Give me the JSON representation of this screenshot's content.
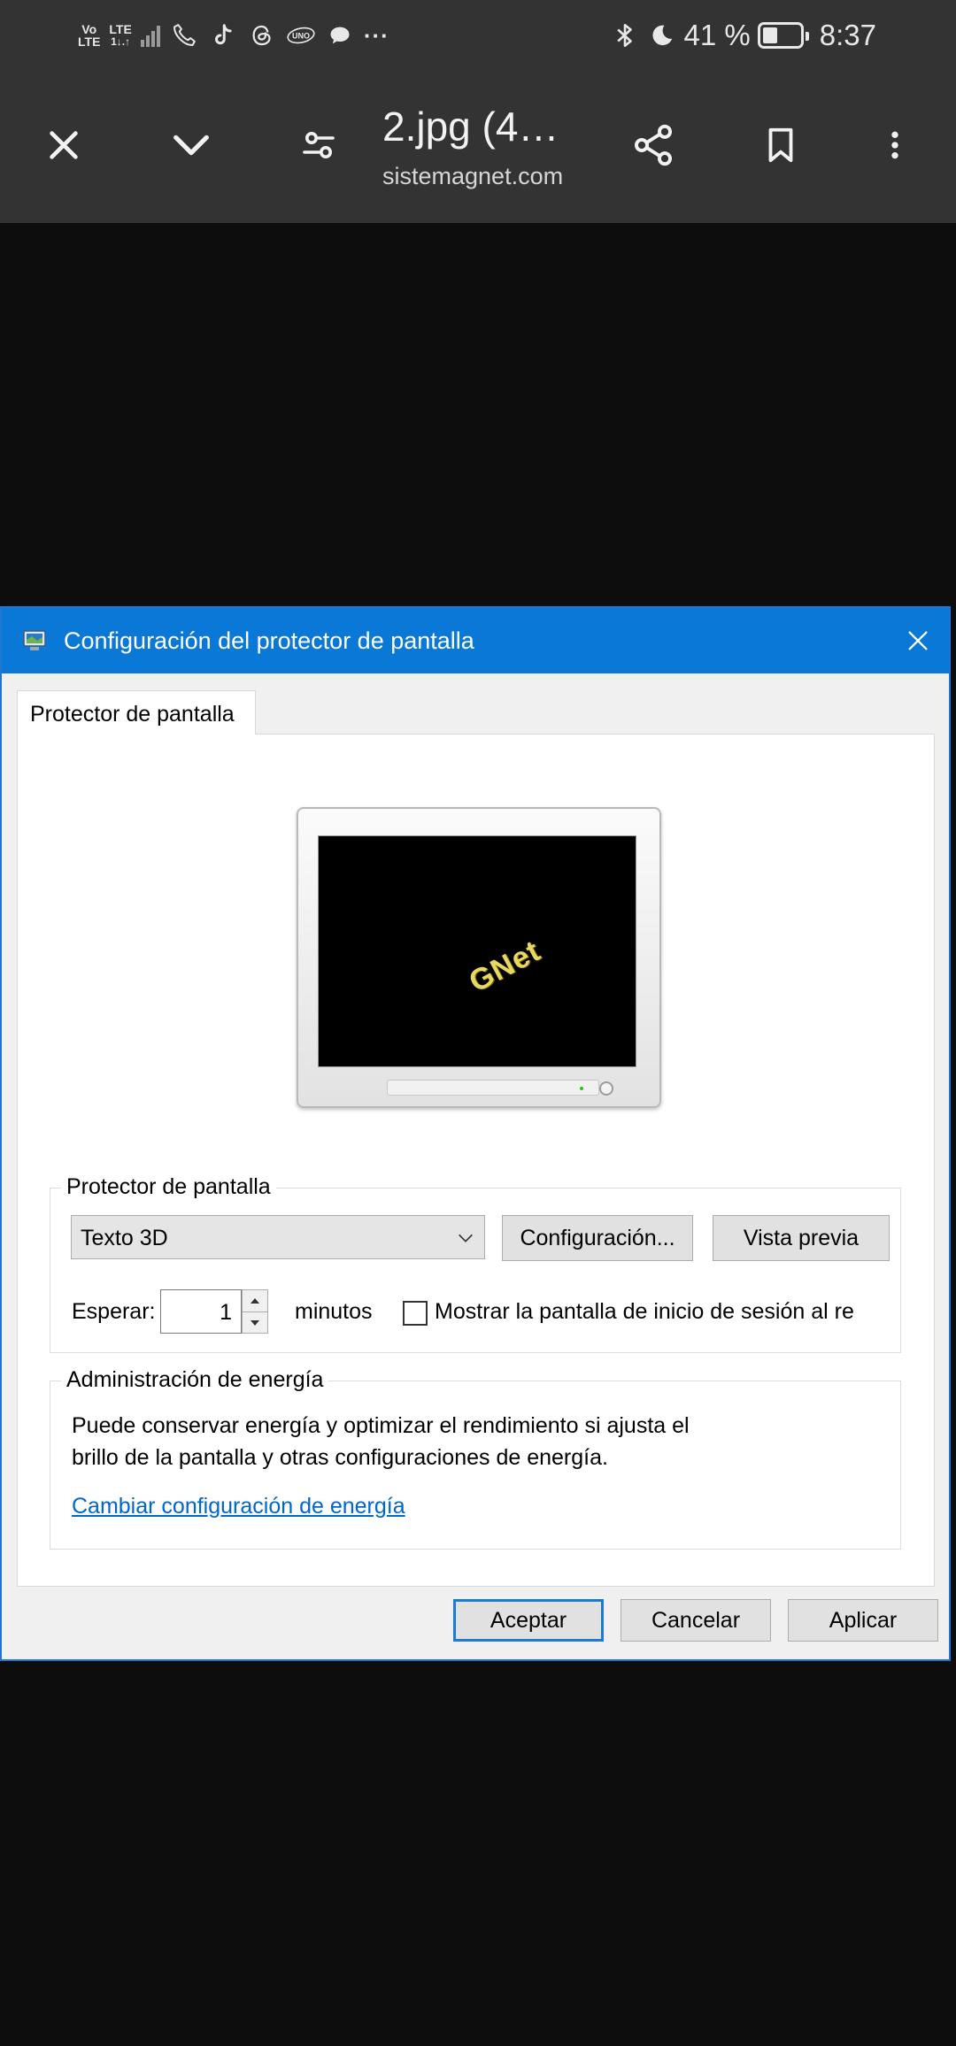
{
  "status_bar": {
    "volte_top": "Vo",
    "volte_bottom": "LTE",
    "lte_top": "LTE",
    "lte_bottom": "1↓.↑",
    "overflow": "···",
    "battery_level": "41 %",
    "battery_fraction": 0.41,
    "time": "8:37",
    "icons": [
      "phone-icon",
      "tiktok-icon",
      "threads-icon",
      "uno-icon",
      "chat-icon",
      "bluetooth-icon",
      "moon-icon",
      "battery-icon"
    ]
  },
  "toolbar": {
    "title": "2.jpg (4…",
    "subtitle": "sistemagnet.com",
    "icons": [
      "close-icon",
      "chevron-down-icon",
      "page-settings-icon",
      "share-icon",
      "bookmark-icon",
      "more-vert-icon"
    ]
  },
  "dialog": {
    "title": "Configuración del protector de pantalla",
    "tab": "Protector de pantalla",
    "preview_text": "GNet",
    "saver_group": {
      "legend": "Protector de pantalla",
      "selected": "Texto 3D",
      "settings_button": "Configuración...",
      "preview_button": "Vista previa",
      "wait_label": "Esperar:",
      "wait_value": "1",
      "minutes_label": "minutos",
      "logon_checkbox_label": "Mostrar la pantalla de inicio de sesión al re",
      "logon_checked": false
    },
    "power_group": {
      "legend": "Administración de energía",
      "description_line1": "Puede conservar energía y optimizar el rendimiento si ajusta el",
      "description_line2": "brillo de la pantalla y otras configuraciones de energía.",
      "link": "Cambiar configuración de energía"
    },
    "buttons": {
      "ok": "Aceptar",
      "cancel": "Cancelar",
      "apply": "Aplicar"
    },
    "colors": {
      "titlebar": "#0a78d7",
      "link": "#0066cc",
      "default_button_border": "#1f7ad6"
    }
  }
}
